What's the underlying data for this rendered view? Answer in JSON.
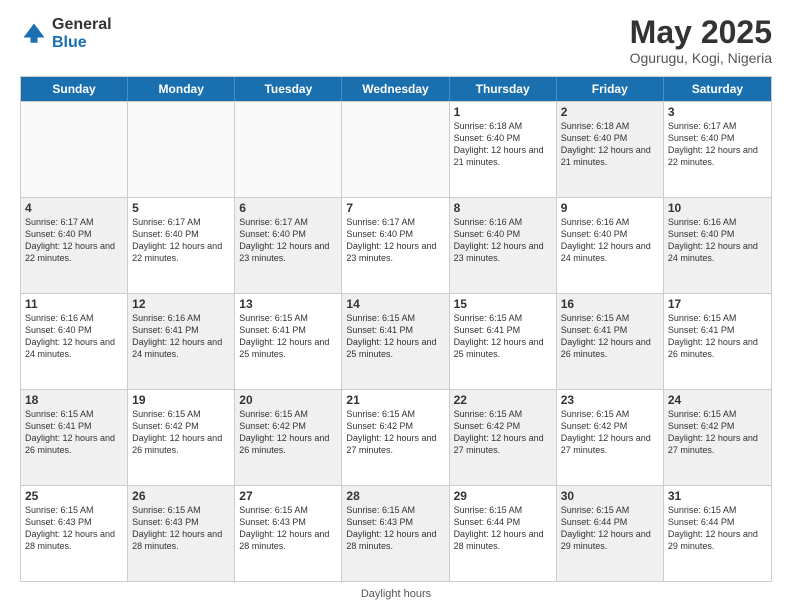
{
  "logo": {
    "general": "General",
    "blue": "Blue"
  },
  "title": "May 2025",
  "location": "Ogurugu, Kogi, Nigeria",
  "days_of_week": [
    "Sunday",
    "Monday",
    "Tuesday",
    "Wednesday",
    "Thursday",
    "Friday",
    "Saturday"
  ],
  "footer": "Daylight hours",
  "weeks": [
    [
      {
        "day": "",
        "info": "",
        "shaded": false,
        "empty": true
      },
      {
        "day": "",
        "info": "",
        "shaded": false,
        "empty": true
      },
      {
        "day": "",
        "info": "",
        "shaded": false,
        "empty": true
      },
      {
        "day": "",
        "info": "",
        "shaded": false,
        "empty": true
      },
      {
        "day": "1",
        "info": "Sunrise: 6:18 AM\nSunset: 6:40 PM\nDaylight: 12 hours\nand 21 minutes.",
        "shaded": false,
        "empty": false
      },
      {
        "day": "2",
        "info": "Sunrise: 6:18 AM\nSunset: 6:40 PM\nDaylight: 12 hours\nand 21 minutes.",
        "shaded": true,
        "empty": false
      },
      {
        "day": "3",
        "info": "Sunrise: 6:17 AM\nSunset: 6:40 PM\nDaylight: 12 hours\nand 22 minutes.",
        "shaded": false,
        "empty": false
      }
    ],
    [
      {
        "day": "4",
        "info": "Sunrise: 6:17 AM\nSunset: 6:40 PM\nDaylight: 12 hours\nand 22 minutes.",
        "shaded": true,
        "empty": false
      },
      {
        "day": "5",
        "info": "Sunrise: 6:17 AM\nSunset: 6:40 PM\nDaylight: 12 hours\nand 22 minutes.",
        "shaded": false,
        "empty": false
      },
      {
        "day": "6",
        "info": "Sunrise: 6:17 AM\nSunset: 6:40 PM\nDaylight: 12 hours\nand 23 minutes.",
        "shaded": true,
        "empty": false
      },
      {
        "day": "7",
        "info": "Sunrise: 6:17 AM\nSunset: 6:40 PM\nDaylight: 12 hours\nand 23 minutes.",
        "shaded": false,
        "empty": false
      },
      {
        "day": "8",
        "info": "Sunrise: 6:16 AM\nSunset: 6:40 PM\nDaylight: 12 hours\nand 23 minutes.",
        "shaded": true,
        "empty": false
      },
      {
        "day": "9",
        "info": "Sunrise: 6:16 AM\nSunset: 6:40 PM\nDaylight: 12 hours\nand 24 minutes.",
        "shaded": false,
        "empty": false
      },
      {
        "day": "10",
        "info": "Sunrise: 6:16 AM\nSunset: 6:40 PM\nDaylight: 12 hours\nand 24 minutes.",
        "shaded": true,
        "empty": false
      }
    ],
    [
      {
        "day": "11",
        "info": "Sunrise: 6:16 AM\nSunset: 6:40 PM\nDaylight: 12 hours\nand 24 minutes.",
        "shaded": false,
        "empty": false
      },
      {
        "day": "12",
        "info": "Sunrise: 6:16 AM\nSunset: 6:41 PM\nDaylight: 12 hours\nand 24 minutes.",
        "shaded": true,
        "empty": false
      },
      {
        "day": "13",
        "info": "Sunrise: 6:15 AM\nSunset: 6:41 PM\nDaylight: 12 hours\nand 25 minutes.",
        "shaded": false,
        "empty": false
      },
      {
        "day": "14",
        "info": "Sunrise: 6:15 AM\nSunset: 6:41 PM\nDaylight: 12 hours\nand 25 minutes.",
        "shaded": true,
        "empty": false
      },
      {
        "day": "15",
        "info": "Sunrise: 6:15 AM\nSunset: 6:41 PM\nDaylight: 12 hours\nand 25 minutes.",
        "shaded": false,
        "empty": false
      },
      {
        "day": "16",
        "info": "Sunrise: 6:15 AM\nSunset: 6:41 PM\nDaylight: 12 hours\nand 26 minutes.",
        "shaded": true,
        "empty": false
      },
      {
        "day": "17",
        "info": "Sunrise: 6:15 AM\nSunset: 6:41 PM\nDaylight: 12 hours\nand 26 minutes.",
        "shaded": false,
        "empty": false
      }
    ],
    [
      {
        "day": "18",
        "info": "Sunrise: 6:15 AM\nSunset: 6:41 PM\nDaylight: 12 hours\nand 26 minutes.",
        "shaded": true,
        "empty": false
      },
      {
        "day": "19",
        "info": "Sunrise: 6:15 AM\nSunset: 6:42 PM\nDaylight: 12 hours\nand 26 minutes.",
        "shaded": false,
        "empty": false
      },
      {
        "day": "20",
        "info": "Sunrise: 6:15 AM\nSunset: 6:42 PM\nDaylight: 12 hours\nand 26 minutes.",
        "shaded": true,
        "empty": false
      },
      {
        "day": "21",
        "info": "Sunrise: 6:15 AM\nSunset: 6:42 PM\nDaylight: 12 hours\nand 27 minutes.",
        "shaded": false,
        "empty": false
      },
      {
        "day": "22",
        "info": "Sunrise: 6:15 AM\nSunset: 6:42 PM\nDaylight: 12 hours\nand 27 minutes.",
        "shaded": true,
        "empty": false
      },
      {
        "day": "23",
        "info": "Sunrise: 6:15 AM\nSunset: 6:42 PM\nDaylight: 12 hours\nand 27 minutes.",
        "shaded": false,
        "empty": false
      },
      {
        "day": "24",
        "info": "Sunrise: 6:15 AM\nSunset: 6:42 PM\nDaylight: 12 hours\nand 27 minutes.",
        "shaded": true,
        "empty": false
      }
    ],
    [
      {
        "day": "25",
        "info": "Sunrise: 6:15 AM\nSunset: 6:43 PM\nDaylight: 12 hours\nand 28 minutes.",
        "shaded": false,
        "empty": false
      },
      {
        "day": "26",
        "info": "Sunrise: 6:15 AM\nSunset: 6:43 PM\nDaylight: 12 hours\nand 28 minutes.",
        "shaded": true,
        "empty": false
      },
      {
        "day": "27",
        "info": "Sunrise: 6:15 AM\nSunset: 6:43 PM\nDaylight: 12 hours\nand 28 minutes.",
        "shaded": false,
        "empty": false
      },
      {
        "day": "28",
        "info": "Sunrise: 6:15 AM\nSunset: 6:43 PM\nDaylight: 12 hours\nand 28 minutes.",
        "shaded": true,
        "empty": false
      },
      {
        "day": "29",
        "info": "Sunrise: 6:15 AM\nSunset: 6:44 PM\nDaylight: 12 hours\nand 28 minutes.",
        "shaded": false,
        "empty": false
      },
      {
        "day": "30",
        "info": "Sunrise: 6:15 AM\nSunset: 6:44 PM\nDaylight: 12 hours\nand 29 minutes.",
        "shaded": true,
        "empty": false
      },
      {
        "day": "31",
        "info": "Sunrise: 6:15 AM\nSunset: 6:44 PM\nDaylight: 12 hours\nand 29 minutes.",
        "shaded": false,
        "empty": false
      }
    ]
  ]
}
